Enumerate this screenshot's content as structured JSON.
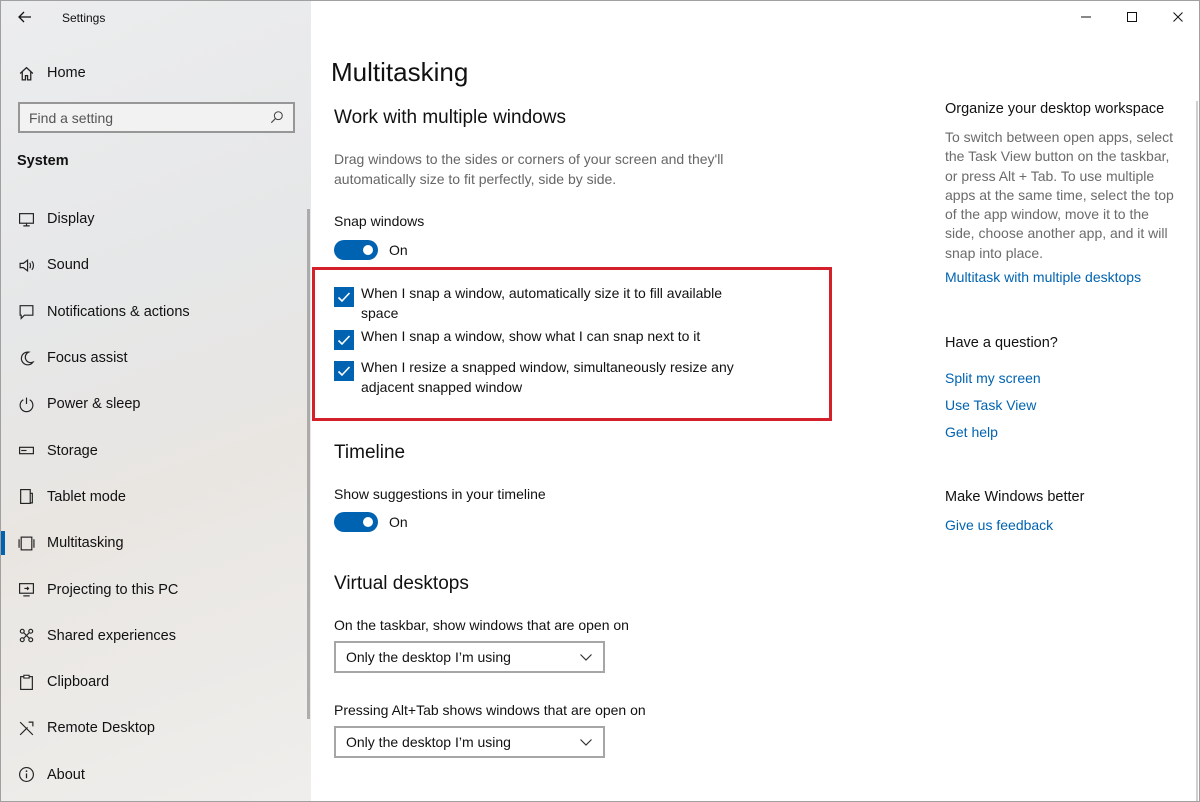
{
  "window": {
    "title": "Settings"
  },
  "sidebar": {
    "home_label": "Home",
    "search": {
      "placeholder": "Find a setting",
      "value": ""
    },
    "section_label": "System",
    "items": [
      {
        "label": "Display",
        "icon": "display-icon"
      },
      {
        "label": "Sound",
        "icon": "sound-icon"
      },
      {
        "label": "Notifications & actions",
        "icon": "notifications-icon"
      },
      {
        "label": "Focus assist",
        "icon": "focus-assist-icon"
      },
      {
        "label": "Power & sleep",
        "icon": "power-icon"
      },
      {
        "label": "Storage",
        "icon": "storage-icon"
      },
      {
        "label": "Tablet mode",
        "icon": "tablet-mode-icon"
      },
      {
        "label": "Multitasking",
        "icon": "multitasking-icon",
        "active": true
      },
      {
        "label": "Projecting to this PC",
        "icon": "projecting-icon"
      },
      {
        "label": "Shared experiences",
        "icon": "shared-experiences-icon"
      },
      {
        "label": "Clipboard",
        "icon": "clipboard-icon"
      },
      {
        "label": "Remote Desktop",
        "icon": "remote-desktop-icon"
      },
      {
        "label": "About",
        "icon": "about-icon"
      }
    ]
  },
  "main": {
    "page_title": "Multitasking",
    "work": {
      "heading": "Work with multiple windows",
      "description": "Drag windows to the sides or corners of your screen and they'll automatically size to fit perfectly, side by side.",
      "snap_label": "Snap windows",
      "snap_state": "On",
      "checks": [
        {
          "label": "When I snap a window, automatically size it to fill available space",
          "checked": true
        },
        {
          "label": "When I snap a window, show what I can snap next to it",
          "checked": true
        },
        {
          "label": "When I resize a snapped window, simultaneously resize any adjacent snapped window",
          "checked": true
        }
      ]
    },
    "timeline": {
      "heading": "Timeline",
      "label": "Show suggestions in your timeline",
      "state": "On"
    },
    "virtual": {
      "heading": "Virtual desktops",
      "taskbar_label": "On the taskbar, show windows that are open on",
      "taskbar_value": "Only the desktop I’m using",
      "alttab_label": "Pressing Alt+Tab shows windows that are open on",
      "alttab_value": "Only the desktop I’m using"
    }
  },
  "right": {
    "organize_heading": "Organize your desktop workspace",
    "organize_desc": "To switch between open apps, select the Task View button on the taskbar, or press Alt + Tab. To use multiple apps at the same time, select the top of the app window, move it to the side, choose another app, and it will snap into place.",
    "organize_link": "Multitask with multiple desktops",
    "question_heading": "Have a question?",
    "links": [
      "Split my screen",
      "Use Task View",
      "Get help"
    ],
    "better_heading": "Make Windows better",
    "feedback_link": "Give us feedback"
  },
  "colors": {
    "accent": "#0063b1",
    "highlight": "#d4202a"
  }
}
